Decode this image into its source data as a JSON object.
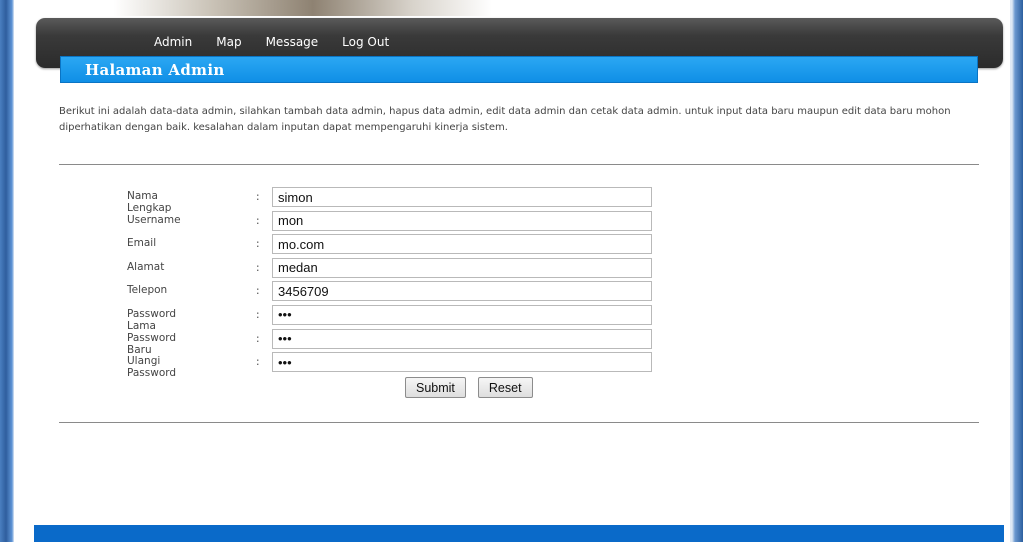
{
  "menu": {
    "items": [
      {
        "label": "Admin"
      },
      {
        "label": "Map"
      },
      {
        "label": "Message"
      },
      {
        "label": "Log Out"
      }
    ]
  },
  "page_title": "Halaman Admin",
  "intro_text": "Berikut ini adalah data-data admin, silahkan tambah data admin, hapus data admin, edit data admin dan cetak data admin. untuk input data baru maupun edit data baru mohon diperhatikan dengan baik. kesalahan dalam inputan dapat mempengaruhi kinerja sistem.",
  "form": {
    "fields": [
      {
        "label": "Nama Lengkap",
        "colon": ":",
        "value": "simon",
        "type": "text"
      },
      {
        "label": "Username",
        "colon": ":",
        "value": "mon",
        "type": "text"
      },
      {
        "label": "Email",
        "colon": ":",
        "value": "mo.com",
        "type": "text"
      },
      {
        "label": "Alamat",
        "colon": ":",
        "value": "medan",
        "type": "text"
      },
      {
        "label": "Telepon",
        "colon": ":",
        "value": "3456709",
        "type": "text"
      },
      {
        "label": "Password Lama",
        "colon": ":",
        "value": "mon",
        "type": "password"
      },
      {
        "label": "Password Baru",
        "colon": ":",
        "value": "mon",
        "type": "password"
      },
      {
        "label": "Ulangi Password",
        "colon": ":",
        "value": "mon",
        "type": "password"
      }
    ],
    "submit_label": "Submit",
    "reset_label": "Reset"
  },
  "colors": {
    "menubar": "#2b2b2b",
    "title_bar": "#0f8fe6",
    "footer": "#0a6ac9"
  }
}
